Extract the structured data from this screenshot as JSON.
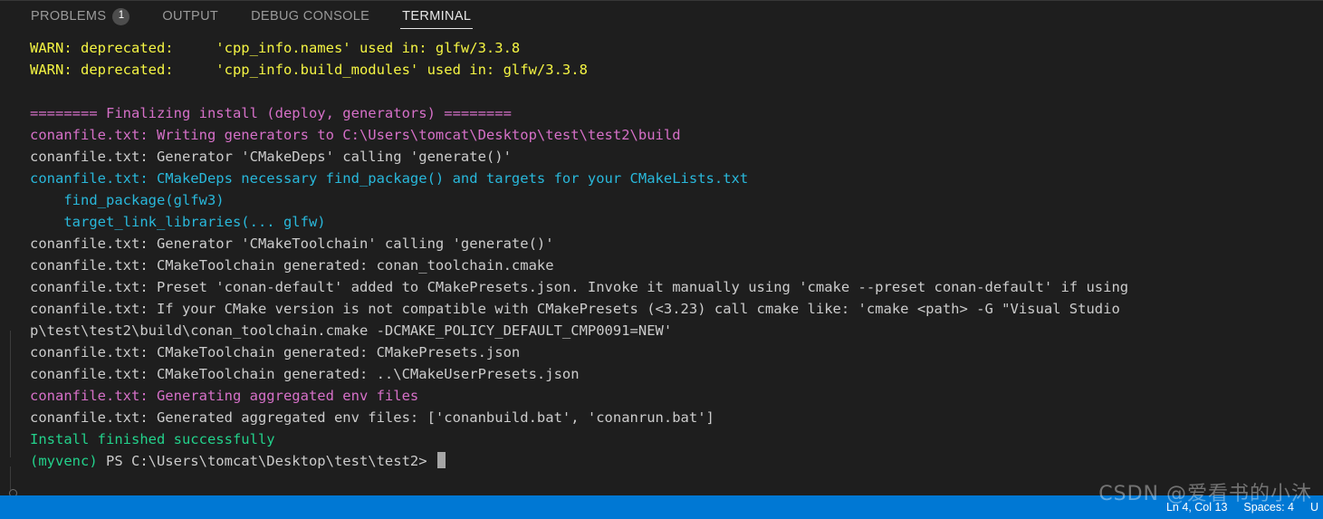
{
  "panel": {
    "tabs": [
      {
        "label": "PROBLEMS",
        "badge": "1",
        "active": false
      },
      {
        "label": "OUTPUT",
        "badge": null,
        "active": false
      },
      {
        "label": "DEBUG CONSOLE",
        "badge": null,
        "active": false
      },
      {
        "label": "TERMINAL",
        "badge": null,
        "active": true
      }
    ]
  },
  "terminal": {
    "colors": {
      "background": "#1e1e1e",
      "foreground": "#cccccc",
      "yellow": "#f5f543",
      "magenta": "#d670c8",
      "cyan": "#29b8db",
      "green": "#23d18b"
    },
    "lines": [
      {
        "text": "WARN: deprecated:     'cpp_info.names' used in: glfw/3.3.8",
        "color": "yellow"
      },
      {
        "text": "WARN: deprecated:     'cpp_info.build_modules' used in: glfw/3.3.8",
        "color": "yellow"
      },
      {
        "text": "",
        "color": "white"
      },
      {
        "text": "======== Finalizing install (deploy, generators) ========",
        "color": "magenta"
      },
      {
        "text": "conanfile.txt: Writing generators to C:\\Users\\tomcat\\Desktop\\test\\test2\\build",
        "color": "magenta"
      },
      {
        "text": "conanfile.txt: Generator 'CMakeDeps' calling 'generate()'",
        "color": "white"
      },
      {
        "text": "conanfile.txt: CMakeDeps necessary find_package() and targets for your CMakeLists.txt",
        "color": "cyan"
      },
      {
        "text": "    find_package(glfw3)",
        "color": "cyan"
      },
      {
        "text": "    target_link_libraries(... glfw)",
        "color": "cyan"
      },
      {
        "text": "conanfile.txt: Generator 'CMakeToolchain' calling 'generate()'",
        "color": "white"
      },
      {
        "text": "conanfile.txt: CMakeToolchain generated: conan_toolchain.cmake",
        "color": "white"
      },
      {
        "text": "conanfile.txt: Preset 'conan-default' added to CMakePresets.json. Invoke it manually using 'cmake --preset conan-default' if using",
        "color": "white"
      },
      {
        "text": "conanfile.txt: If your CMake version is not compatible with CMakePresets (<3.23) call cmake like: 'cmake <path> -G \"Visual Studio",
        "color": "white"
      },
      {
        "text": "p\\test\\test2\\build\\conan_toolchain.cmake -DCMAKE_POLICY_DEFAULT_CMP0091=NEW'",
        "color": "white"
      },
      {
        "text": "conanfile.txt: CMakeToolchain generated: CMakePresets.json",
        "color": "white"
      },
      {
        "text": "conanfile.txt: CMakeToolchain generated: ..\\CMakeUserPresets.json",
        "color": "white"
      },
      {
        "text": "conanfile.txt: Generating aggregated env files",
        "color": "magenta"
      },
      {
        "text": "conanfile.txt: Generated aggregated env files: ['conanbuild.bat', 'conanrun.bat']",
        "color": "white"
      },
      {
        "text": "Install finished successfully",
        "color": "green"
      }
    ],
    "prompt": {
      "venv": "(myvenc)",
      "shell": "PS",
      "path": "C:\\Users\\tomcat\\Desktop\\test\\test2>"
    }
  },
  "statusbar": {
    "line_col": "Ln 4, Col 13",
    "spaces": "Spaces: 4",
    "encoding_partial": "U"
  },
  "watermark": {
    "text": "CSDN @爱看书的小沐"
  }
}
